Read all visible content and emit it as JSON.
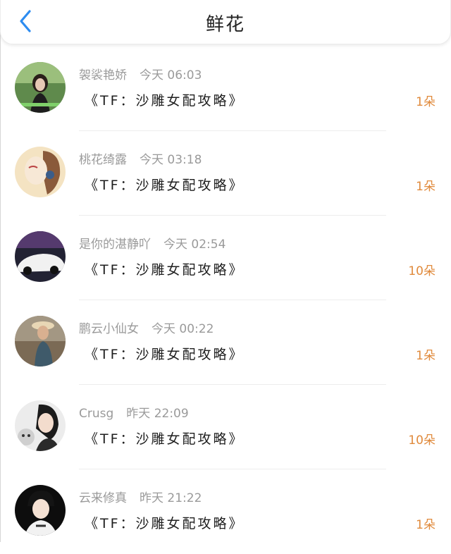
{
  "header": {
    "title": "鲜花",
    "accent_color": "#2d8cf0"
  },
  "rows": [
    {
      "name": "袈裟艳娇",
      "time": "今天 06:03",
      "book": "《TF：沙雕女配攻略》",
      "count": "1朵"
    },
    {
      "name": "桃花绮露",
      "time": "今天 03:18",
      "book": "《TF：沙雕女配攻略》",
      "count": "1朵"
    },
    {
      "name": "是你的湛静吖",
      "time": "今天 02:54",
      "book": "《TF：沙雕女配攻略》",
      "count": "10朵"
    },
    {
      "name": "鹏云小仙女",
      "time": "今天 00:22",
      "book": "《TF：沙雕女配攻略》",
      "count": "1朵"
    },
    {
      "name": "Crusg",
      "time": "昨天 22:09",
      "book": "《TF：沙雕女配攻略》",
      "count": "10朵"
    },
    {
      "name": "云来修真",
      "time": "昨天 21:22",
      "book": "《TF：沙雕女配攻略》",
      "count": "1朵"
    }
  ]
}
